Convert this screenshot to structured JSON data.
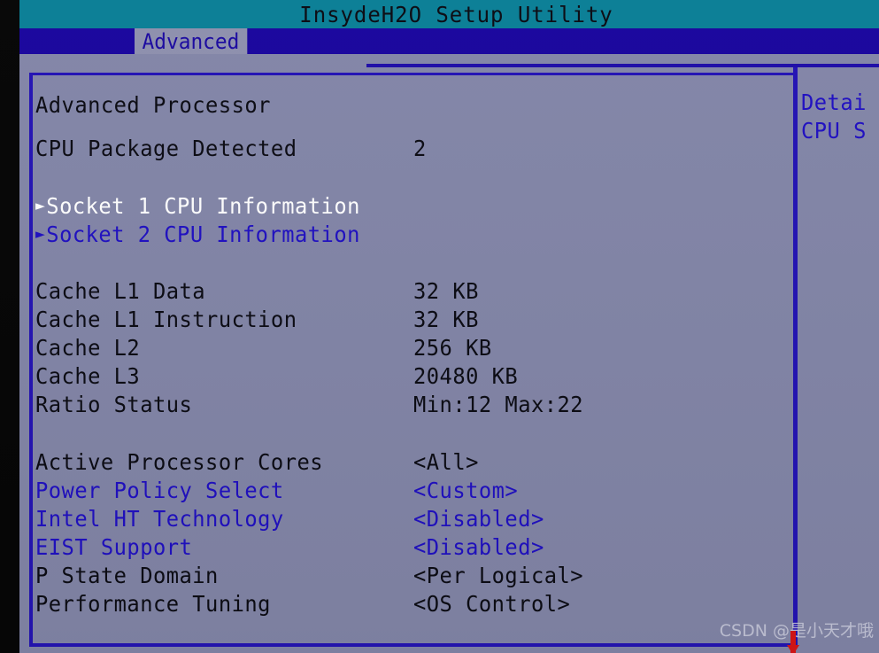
{
  "window": {
    "title": "InsydeH2O Setup Utility"
  },
  "menubar": {
    "active_tab": "Advanced"
  },
  "panel": {
    "heading": "Advanced Processor",
    "rows": [
      {
        "label": "CPU Package Detected",
        "value": "2",
        "label_color": "black",
        "value_color": "black",
        "bullet": "",
        "selected": false
      },
      {
        "label": "Socket 1 CPU Information",
        "value": "",
        "label_color": "white",
        "value_color": "white",
        "bullet": "►",
        "selected": true
      },
      {
        "label": "Socket 2 CPU Information",
        "value": "",
        "label_color": "blue",
        "value_color": "blue",
        "bullet": "►",
        "selected": false
      },
      {
        "label": "Cache L1 Data",
        "value": "32 KB",
        "label_color": "black",
        "value_color": "black",
        "bullet": "",
        "selected": false
      },
      {
        "label": "Cache L1 Instruction",
        "value": "32 KB",
        "label_color": "black",
        "value_color": "black",
        "bullet": "",
        "selected": false
      },
      {
        "label": "Cache L2",
        "value": "256 KB",
        "label_color": "black",
        "value_color": "black",
        "bullet": "",
        "selected": false
      },
      {
        "label": "Cache L3",
        "value": "20480 KB",
        "label_color": "black",
        "value_color": "black",
        "bullet": "",
        "selected": false
      },
      {
        "label": "Ratio Status",
        "value": "Min:12 Max:22",
        "label_color": "black",
        "value_color": "black",
        "bullet": "",
        "selected": false
      },
      {
        "label": "Active Processor Cores",
        "value": "<All>",
        "label_color": "black",
        "value_color": "black",
        "bullet": "",
        "selected": false
      },
      {
        "label": "Power Policy Select",
        "value": "<Custom>",
        "label_color": "blue",
        "value_color": "blue",
        "bullet": "",
        "selected": false
      },
      {
        "label": "Intel HT Technology",
        "value": "<Disabled>",
        "label_color": "blue",
        "value_color": "blue",
        "bullet": "",
        "selected": false
      },
      {
        "label": "EIST Support",
        "value": "<Disabled>",
        "label_color": "blue",
        "value_color": "blue",
        "bullet": "",
        "selected": false
      },
      {
        "label": "P State Domain",
        "value": "<Per Logical>",
        "label_color": "black",
        "value_color": "black",
        "bullet": "",
        "selected": false
      },
      {
        "label": "Performance Tuning",
        "value": "<OS Control>",
        "label_color": "black",
        "value_color": "black",
        "bullet": "",
        "selected": false
      }
    ]
  },
  "help": {
    "lines": [
      "Detai",
      "CPU S"
    ]
  },
  "watermark": {
    "text": "CSDN @是小天才哦"
  },
  "colors": {
    "titlebar_teal": "#0a7f96",
    "menubar_blue": "#1a069e",
    "body_gray": "#8386a8",
    "border_blue": "#2414b4",
    "text_blue": "#2010c2",
    "text_black": "#0c0c14",
    "text_white": "#ffffff",
    "cursor_red": "#d81616"
  }
}
